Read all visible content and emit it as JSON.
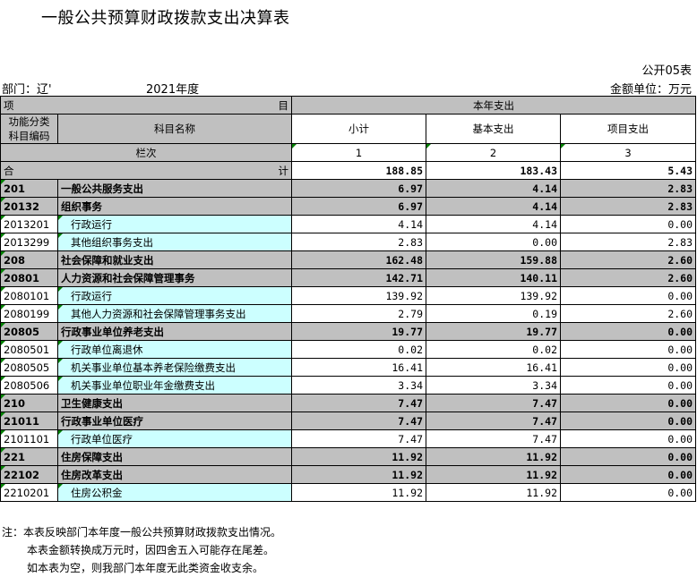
{
  "title": "一般公共预算财政拨款支出决算表",
  "form_no": "公开05表",
  "dept": "部门：辽'",
  "year": "2021年度",
  "unit": "金额单位：万元",
  "header": {
    "item_left": "项",
    "item_right": "目",
    "current": "本年支出",
    "code": "功能分类\n科目编码",
    "name": "科目名称",
    "subtotal": "小计",
    "basic": "基本支出",
    "project": "项目支出",
    "col_label": "栏次",
    "col1": "1",
    "col2": "2",
    "col3": "3"
  },
  "total": {
    "left": "合",
    "right": "计",
    "subtotal": "188.85",
    "basic": "183.43",
    "project": "5.43"
  },
  "rows": [
    {
      "code": "201",
      "name": "一般公共服务支出",
      "subtotal": "6.97",
      "basic": "4.14",
      "project": "2.83",
      "level": "bold"
    },
    {
      "code": "20132",
      "name": "组织事务",
      "subtotal": "6.97",
      "basic": "4.14",
      "project": "2.83",
      "level": "bold"
    },
    {
      "code": "2013201",
      "name": "行政运行",
      "subtotal": "4.14",
      "basic": "4.14",
      "project": "0.00",
      "level": "leaf"
    },
    {
      "code": "2013299",
      "name": "其他组织事务支出",
      "subtotal": "2.83",
      "basic": "0.00",
      "project": "2.83",
      "level": "leaf"
    },
    {
      "code": "208",
      "name": "社会保障和就业支出",
      "subtotal": "162.48",
      "basic": "159.88",
      "project": "2.60",
      "level": "bold"
    },
    {
      "code": "20801",
      "name": "人力资源和社会保障管理事务",
      "subtotal": "142.71",
      "basic": "140.11",
      "project": "2.60",
      "level": "bold"
    },
    {
      "code": "2080101",
      "name": "行政运行",
      "subtotal": "139.92",
      "basic": "139.92",
      "project": "0.00",
      "level": "leaf"
    },
    {
      "code": "2080199",
      "name": "其他人力资源和社会保障管理事务支出",
      "subtotal": "2.79",
      "basic": "0.19",
      "project": "2.60",
      "level": "leaf"
    },
    {
      "code": "20805",
      "name": "行政事业单位养老支出",
      "subtotal": "19.77",
      "basic": "19.77",
      "project": "0.00",
      "level": "bold"
    },
    {
      "code": "2080501",
      "name": "行政单位离退休",
      "subtotal": "0.02",
      "basic": "0.02",
      "project": "0.00",
      "level": "leaf"
    },
    {
      "code": "2080505",
      "name": "机关事业单位基本养老保险缴费支出",
      "subtotal": "16.41",
      "basic": "16.41",
      "project": "0.00",
      "level": "leaf"
    },
    {
      "code": "2080506",
      "name": "机关事业单位职业年金缴费支出",
      "subtotal": "3.34",
      "basic": "3.34",
      "project": "0.00",
      "level": "leaf"
    },
    {
      "code": "210",
      "name": "卫生健康支出",
      "subtotal": "7.47",
      "basic": "7.47",
      "project": "0.00",
      "level": "bold"
    },
    {
      "code": "21011",
      "name": "行政事业单位医疗",
      "subtotal": "7.47",
      "basic": "7.47",
      "project": "0.00",
      "level": "bold"
    },
    {
      "code": "2101101",
      "name": "行政单位医疗",
      "subtotal": "7.47",
      "basic": "7.47",
      "project": "0.00",
      "level": "leaf"
    },
    {
      "code": "221",
      "name": "住房保障支出",
      "subtotal": "11.92",
      "basic": "11.92",
      "project": "0.00",
      "level": "bold"
    },
    {
      "code": "22102",
      "name": "住房改革支出",
      "subtotal": "11.92",
      "basic": "11.92",
      "project": "0.00",
      "level": "bold"
    },
    {
      "code": "2210201",
      "name": "住房公积金",
      "subtotal": "11.92",
      "basic": "11.92",
      "project": "0.00",
      "level": "leaf"
    }
  ],
  "notes": [
    "注：本表反映部门本年度一般公共预算财政拨款支出情况。",
    "本表金额转换成万元时，因四舍五入可能存在尾差。",
    "如本表为空，则我部门本年度无此类资金收支余。"
  ],
  "colors": {
    "header_gray": "#c0c0c0",
    "leaf_cyan": "#ccffff",
    "marker_green": "#008000"
  }
}
